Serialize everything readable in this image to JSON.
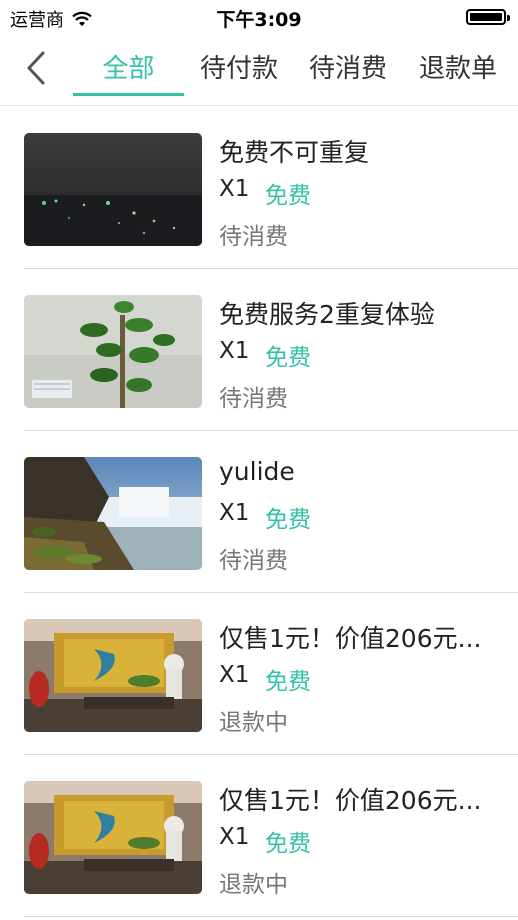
{
  "status_bar": {
    "carrier": "运营商",
    "time": "下午3:09"
  },
  "tabs": [
    {
      "label": "全部",
      "active": true
    },
    {
      "label": "待付款",
      "active": false
    },
    {
      "label": "待消费",
      "active": false
    },
    {
      "label": "退款单",
      "active": false
    }
  ],
  "colors": {
    "accent": "#33c2a6",
    "status_text": "#777777"
  },
  "orders": [
    {
      "title": "免费不可重复",
      "qty": "X1",
      "price": "免费",
      "status": "待消费",
      "image": "night-city-photo"
    },
    {
      "title": "免费服务2重复体验",
      "qty": "X1",
      "price": "免费",
      "status": "待消费",
      "image": "potted-plant-photo"
    },
    {
      "title": "yulide",
      "qty": "X1",
      "price": "免费",
      "status": "待消费",
      "image": "waterfall-photo"
    },
    {
      "title": "仅售1元！价值206元...",
      "qty": "X1",
      "price": "免费",
      "status": "退款中",
      "image": "shop-interior-photo"
    },
    {
      "title": "仅售1元！价值206元...",
      "qty": "X1",
      "price": "免费",
      "status": "退款中",
      "image": "shop-interior-photo"
    }
  ]
}
